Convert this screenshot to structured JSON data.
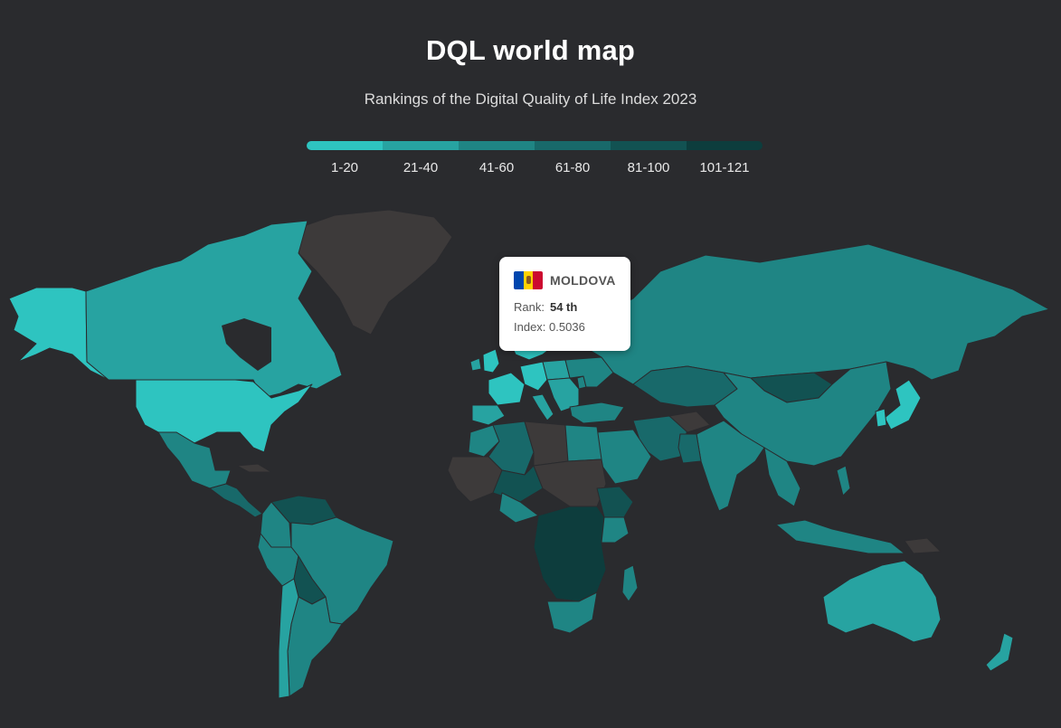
{
  "header": {
    "title": "DQL world map",
    "subtitle": "Rankings of the Digital Quality of Life Index 2023"
  },
  "legend": {
    "items": [
      {
        "label": "1-20",
        "color": "#2ec4c0"
      },
      {
        "label": "21-40",
        "color": "#27a3a1"
      },
      {
        "label": "41-60",
        "color": "#1f8584"
      },
      {
        "label": "61-80",
        "color": "#18696a"
      },
      {
        "label": "81-100",
        "color": "#125252"
      },
      {
        "label": "101-121",
        "color": "#0d3d3d"
      }
    ]
  },
  "map": {
    "background": "#2a2b2e",
    "no_data_color": "#3d3a3a"
  },
  "tooltip": {
    "country": "MOLDOVA",
    "flag_colors": [
      "#0046ae",
      "#ffd200",
      "#cc092f"
    ],
    "rank_label": "Rank:",
    "rank_value": "54 th",
    "index_label": "Index:",
    "index_value": "0.5036"
  }
}
